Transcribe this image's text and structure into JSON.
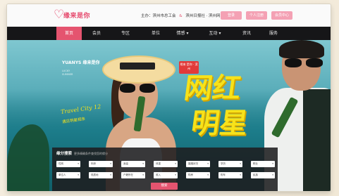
{
  "logo": {
    "icon": "heart-icon",
    "text": "缘来是你"
  },
  "hosts": [
    "主办：滨州市总工会",
    "&",
    "滨州日报社 · 滨州网"
  ],
  "header_buttons": [
    "登录",
    "个人注册",
    "会员中心"
  ],
  "nav": {
    "items": [
      "首页",
      "会员",
      "专区",
      "单位",
      "情感",
      "互动",
      "资讯",
      "服务"
    ],
    "active_index": 0,
    "dropdown_indices": [
      4,
      5
    ]
  },
  "banner": {
    "brand": "YUANYS 缘来是你",
    "brand_sub": "LUCKY\nSUMMER",
    "badge": "缘来 是你 · 滨州",
    "script_line": "Travel City 12",
    "script_line2": "遇见明星相亲",
    "headline_top": "网红",
    "headline_bottom": "明星"
  },
  "search": {
    "title": "缘分搜索",
    "subtitle": "更多精确条件查找您的缘分",
    "row1": [
      "性别",
      "年龄",
      "身高",
      "体重",
      "婚姻状况",
      "学历",
      "职业"
    ],
    "row2": [
      "单位人",
      "现居地",
      "户籍所在",
      "收入",
      "购房",
      "购车",
      "民族"
    ],
    "button": "搜索"
  },
  "colors": {
    "accent": "#e5546f",
    "nav_bg": "#161618",
    "headline": "#f7e21a",
    "button_pink": "#f4a1b4"
  }
}
